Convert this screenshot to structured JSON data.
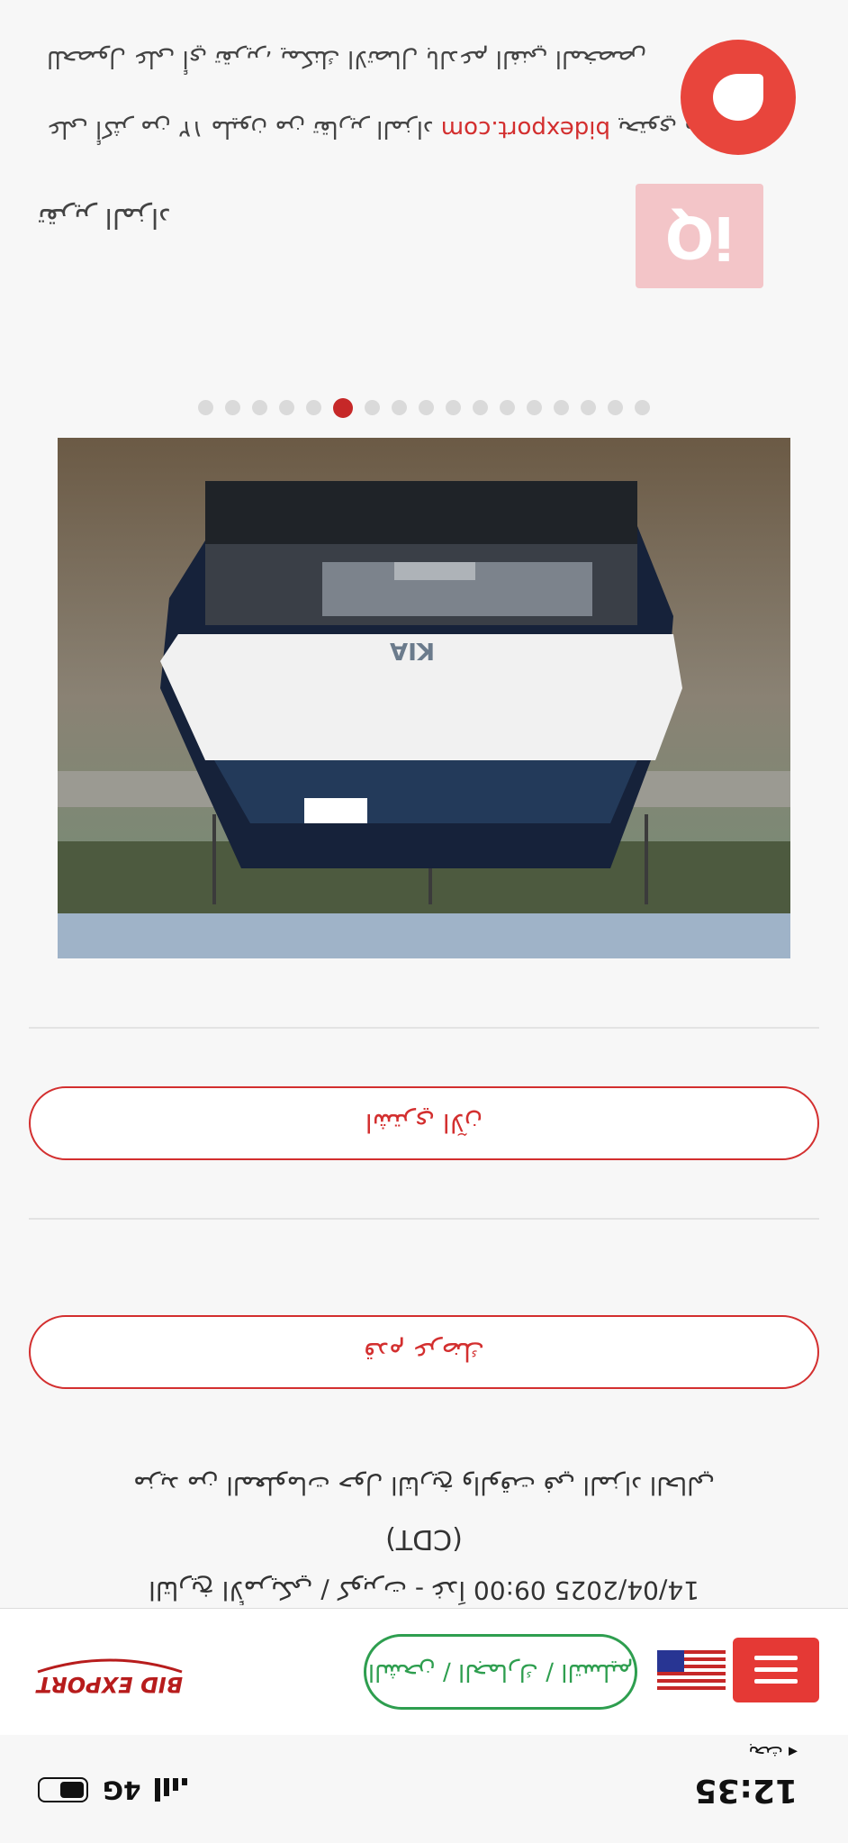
{
  "status_bar": {
    "time": "12:35",
    "back_label": "◂ بحث",
    "network": "4G"
  },
  "header": {
    "calculator_label": "الشحن / الجمارك / التسليم"
  },
  "lot": {
    "meta": "التاريخ الأمريكي / كوبرت - غداً 09:00 14/04/2025",
    "meta_tz": "(CDT)",
    "more_info": "مزيد من المعلومات حول التاريخ والوقت في المزاد الحالي"
  },
  "buttons": {
    "bid": "قدم عرضك",
    "buy_now": "اشتري الآن"
  },
  "gallery": {
    "total_images": 17,
    "active_index": 4
  },
  "report": {
    "title": "تقرير المزاد",
    "note_prefix": "يحتوي موقع",
    "note_link": "bidexport.com",
    "note_suffix": "على أكثر من ١٢ مليون من تقارير المزاد",
    "note2": "للحصول على أي تقرير، يمكنك الاتصال بالدعم الفني المخصص"
  },
  "iq_badge": "iQ",
  "colors": {
    "accent": "#d32f2f",
    "green": "#2e9e4f"
  }
}
